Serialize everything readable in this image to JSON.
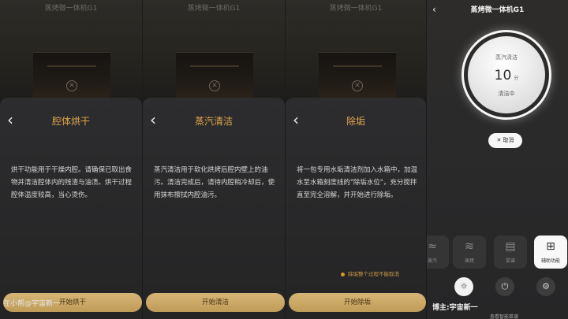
{
  "top_title": "蒸烤微一体机G1",
  "panel1": {
    "title": "腔体烘干",
    "description": "烘干功能用于干燥内腔。请确保已取出食物并清洁腔体内的残渣与油渍。烘干过程腔体温度较高，当心烫伤。",
    "button": "开始烘干",
    "watermark": "在小帮@宇宙新一"
  },
  "panel2": {
    "title": "蒸汽清洁",
    "description": "蒸汽清洁用于软化烘烤后腔内壁上的油污。清洁完成后，请待内腔稍冷却后，使用抹布擦拭内腔油污。",
    "button": "开始清洁"
  },
  "panel3": {
    "title": "除垢",
    "description": "将一包专用水垢清洁剂加入水箱中，加温水至水箱刻度线的\"除垢水位\"，充分搅拌直至完全溶解，并开始进行除垢。",
    "hint": "除垢整个过程不能取消",
    "button": "开始除垢"
  },
  "panel4": {
    "back": "‹",
    "title": "蒸烤微一体机G1",
    "dial": {
      "mode": "蒸汽清洁",
      "value": "10",
      "unit": "分",
      "status": "清洁中"
    },
    "cancel": "✕ 取消",
    "tiles": [
      {
        "icon": "≈",
        "label": "蒸汽"
      },
      {
        "icon": "≋",
        "label": "蒸烤"
      },
      {
        "icon": "▤",
        "label": "菜谱"
      },
      {
        "icon": "⊞",
        "label": "辅助功能"
      }
    ],
    "watermark": "博主:宇宙新一",
    "bottom_label": "查看智能菜谱"
  },
  "colors": {
    "accent": "#e2a64a",
    "button": "#c9a867",
    "sheet": "#2b2b2d"
  }
}
